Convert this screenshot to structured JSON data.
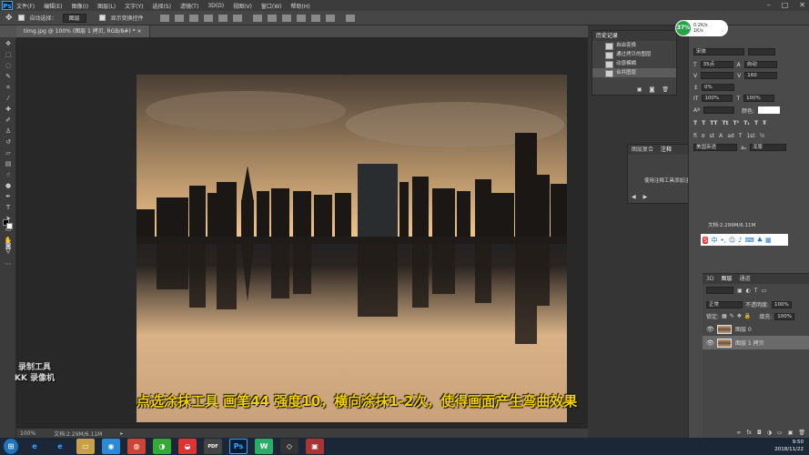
{
  "app": {
    "logo": "Ps"
  },
  "menubar": {
    "items": [
      "文件(F)",
      "编辑(E)",
      "图像(I)",
      "图层(L)",
      "文字(Y)",
      "选择(S)",
      "滤镜(T)",
      "3D(D)",
      "视图(V)",
      "窗口(W)",
      "帮助(H)"
    ]
  },
  "options": {
    "auto_select_label": "自动选择：",
    "auto_select_value": "图层",
    "show_transform_label": "显示变换控件"
  },
  "document": {
    "tab_title": "timg.jpg @ 100% (图层 1 拷贝, RGB/8#) *"
  },
  "status": {
    "zoom": "100%",
    "doc_info": "文档:2.29M/6.11M"
  },
  "subtitle": "点选涂抹工具 画笔44 强度10，横向涂抹1-2次，使得画面产生弯曲效果",
  "watermark": {
    "line1": "录制工具",
    "line2": "KK 录像机"
  },
  "history": {
    "title": "历史记录",
    "items": [
      {
        "label": "自由变换"
      },
      {
        "label": "通过拷贝的图层"
      },
      {
        "label": "动感模糊"
      },
      {
        "label": "合并图层"
      }
    ]
  },
  "notes": {
    "tab1": "图层复合",
    "tab2": "注释",
    "message": "使用注释工具添加注释"
  },
  "badge": {
    "percent": "37%",
    "speed_up": "0.2K/s",
    "speed_down": "1K/s"
  },
  "character": {
    "font": "宋体",
    "size": "35点",
    "leading": "自动",
    "tracking": "160",
    "scale_v": "100%",
    "scale_h": "100%",
    "baseline": "0%",
    "language": "美国英语",
    "aa": "浑厚"
  },
  "doc_size": "文档:2.299M/6.11M",
  "layers": {
    "tabs": [
      "3D",
      "图层",
      "通道"
    ],
    "blend_mode": "正常",
    "opacity_label": "不透明度:",
    "opacity": "100%",
    "fill_label": "填充:",
    "fill": "100%",
    "lock_label": "锁定:",
    "rows": [
      {
        "name": "图层 0"
      },
      {
        "name": "图层 1 拷贝"
      }
    ]
  },
  "taskbar": {
    "time": "9:50",
    "date": "2018/11/22",
    "icons": [
      {
        "label": "e"
      },
      {
        "label": "e"
      },
      {
        "label": "▭"
      },
      {
        "label": "◉"
      },
      {
        "label": "◍"
      },
      {
        "label": "◑"
      },
      {
        "label": "◒"
      },
      {
        "label": "PDF"
      },
      {
        "label": "Ps"
      },
      {
        "label": "W"
      },
      {
        "label": "◇"
      },
      {
        "label": "▣"
      }
    ]
  },
  "colors": {
    "subtitle": "#f3d000",
    "badge": "#27a348",
    "accent": "#31a8ff"
  }
}
